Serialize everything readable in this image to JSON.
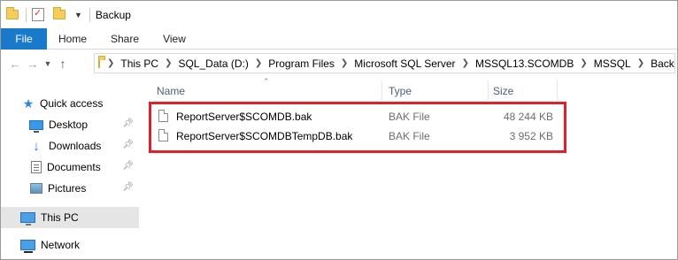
{
  "window": {
    "title": "Backup"
  },
  "ribbon": {
    "tabs": [
      "File",
      "Home",
      "Share",
      "View"
    ]
  },
  "address": {
    "crumbs": [
      "This PC",
      "SQL_Data (D:)",
      "Program Files",
      "Microsoft SQL Server",
      "MSSQL13.SCOMDB",
      "MSSQL",
      "Backup"
    ]
  },
  "sidebar": {
    "items": [
      {
        "label": "Quick access",
        "icon": "star-icon"
      },
      {
        "label": "Desktop",
        "icon": "desktop-icon",
        "pinned": true
      },
      {
        "label": "Downloads",
        "icon": "downloads-icon",
        "pinned": true
      },
      {
        "label": "Documents",
        "icon": "documents-icon",
        "pinned": true
      },
      {
        "label": "Pictures",
        "icon": "pictures-icon",
        "pinned": true
      },
      {
        "label": "This PC",
        "icon": "computer-icon",
        "selected": true
      },
      {
        "label": "Network",
        "icon": "network-icon"
      }
    ]
  },
  "columns": {
    "name": "Name",
    "type": "Type",
    "size": "Size"
  },
  "files": [
    {
      "name": "ReportServer$SCOMDB.bak",
      "type": "BAK File",
      "size": "48 244 KB"
    },
    {
      "name": "ReportServer$SCOMDBTempDB.bak",
      "type": "BAK File",
      "size": "3 952 KB"
    }
  ],
  "colors": {
    "accent": "#1979ca",
    "highlight": "#e0202a",
    "selected_bg": "#e5e5e5"
  }
}
